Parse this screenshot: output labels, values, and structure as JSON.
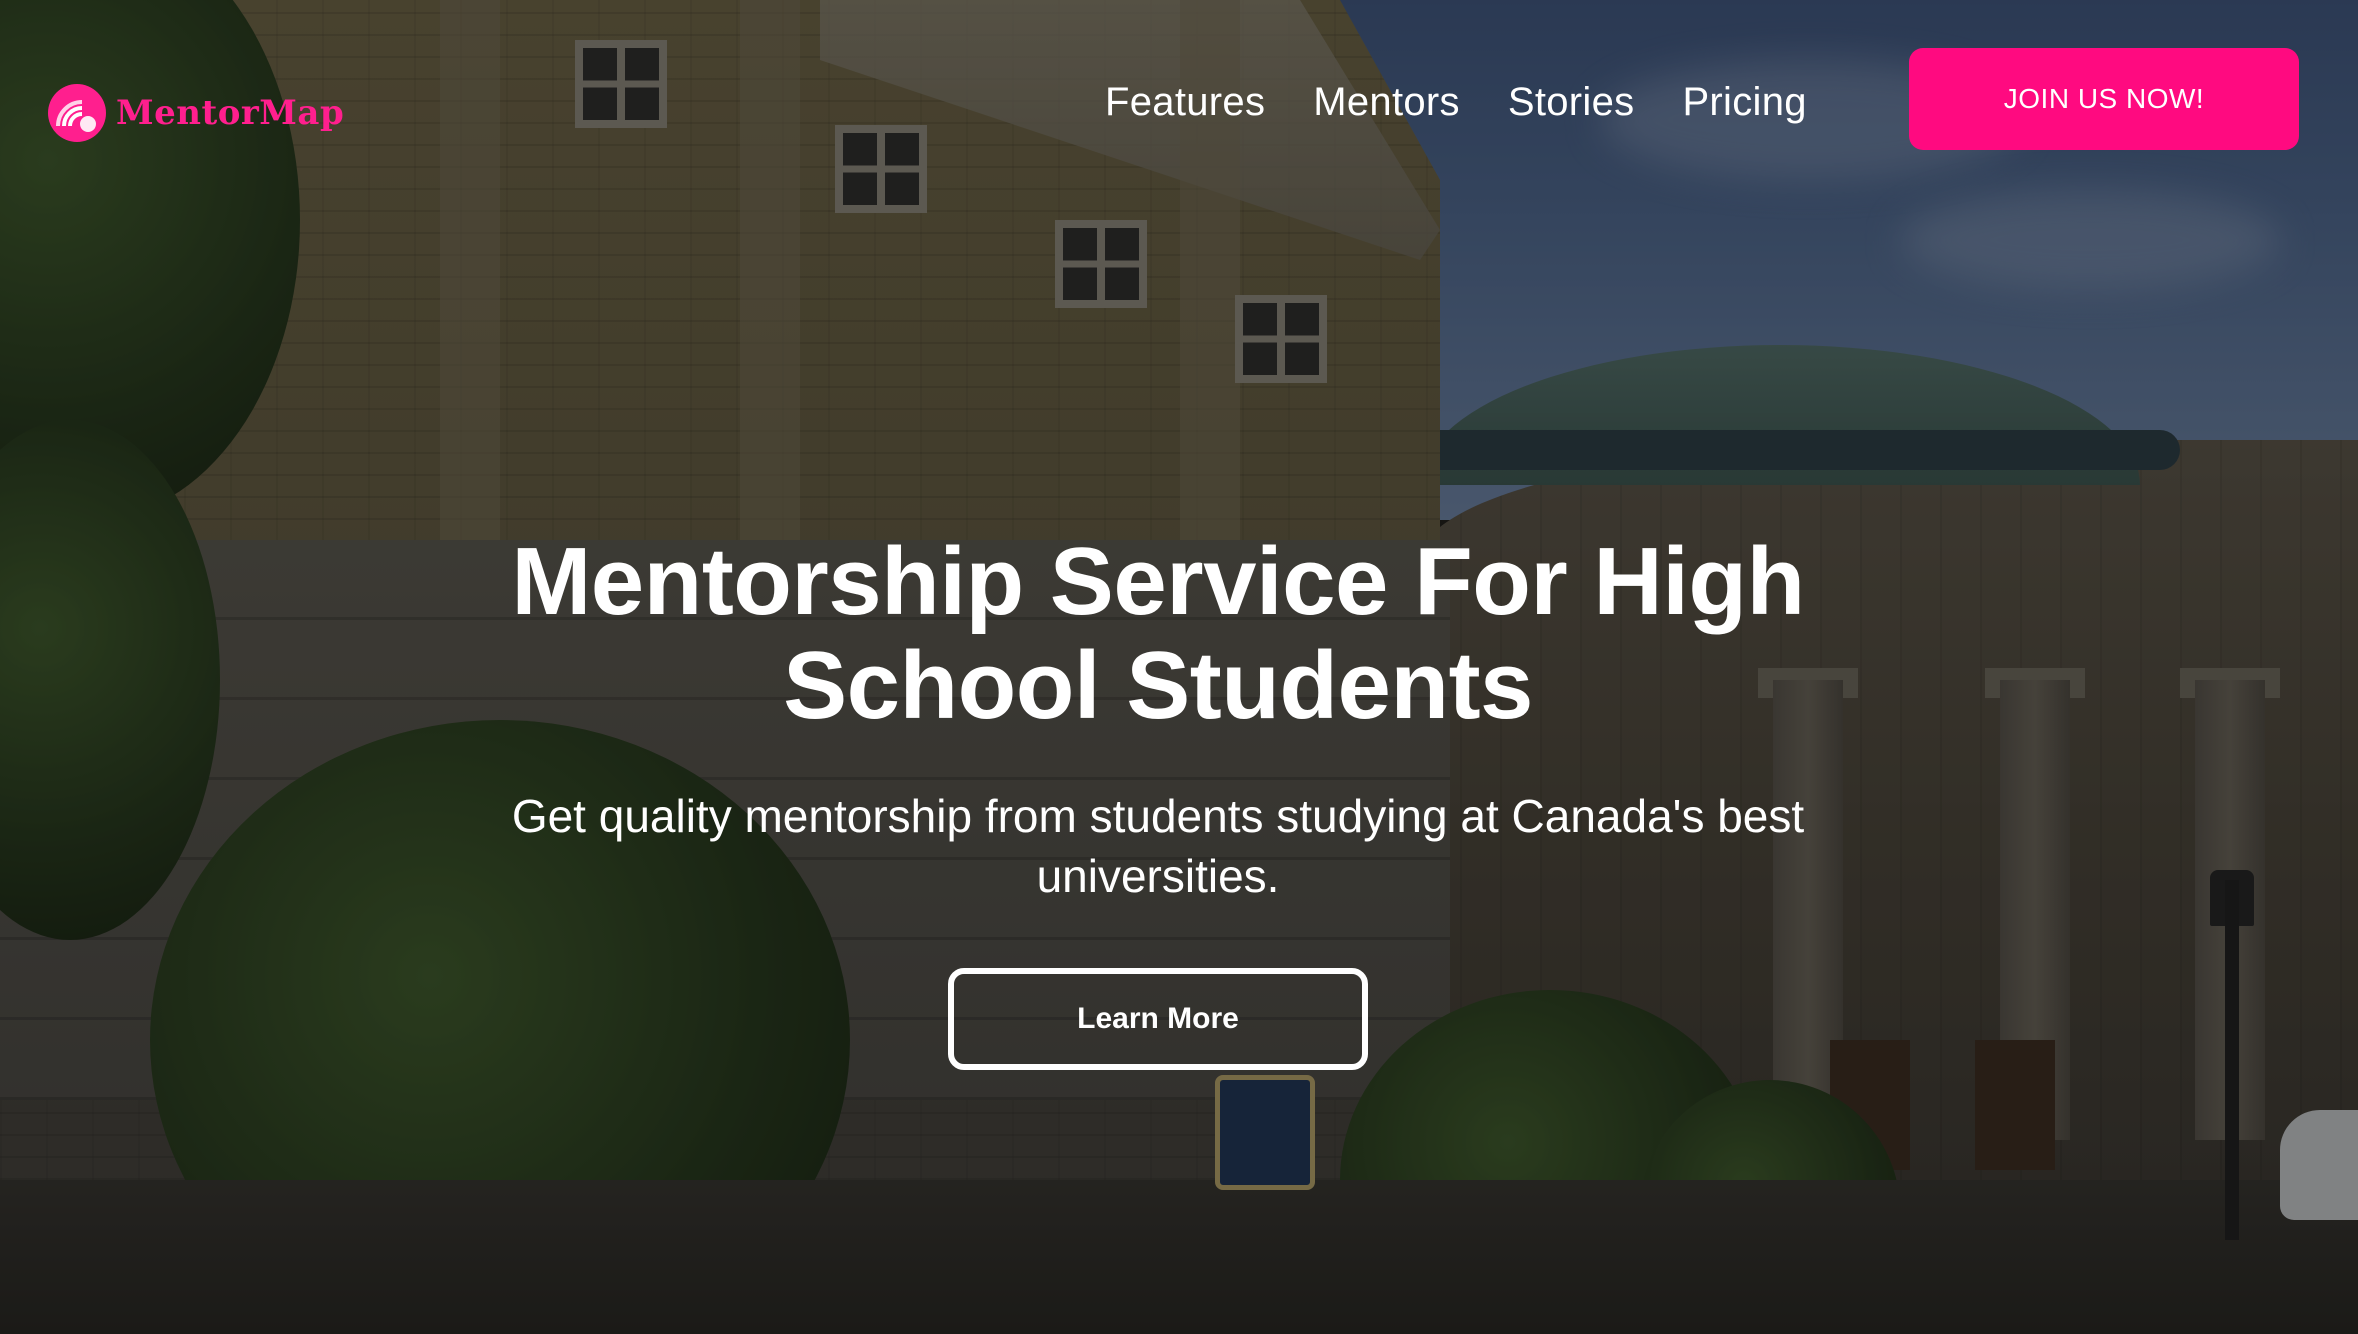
{
  "brand": {
    "name": "MentorMap",
    "accent_color": "#ff0a80",
    "logo_icon": "signal-waves-icon"
  },
  "nav": {
    "items": [
      {
        "label": "Features"
      },
      {
        "label": "Mentors"
      },
      {
        "label": "Stories"
      },
      {
        "label": "Pricing"
      }
    ],
    "cta_label": "JOIN US NOW!"
  },
  "hero": {
    "title": "Mentorship Service For High School Students",
    "subtitle": "Get quality mentorship from students studying at Canada's best universities.",
    "button_label": "Learn More"
  }
}
